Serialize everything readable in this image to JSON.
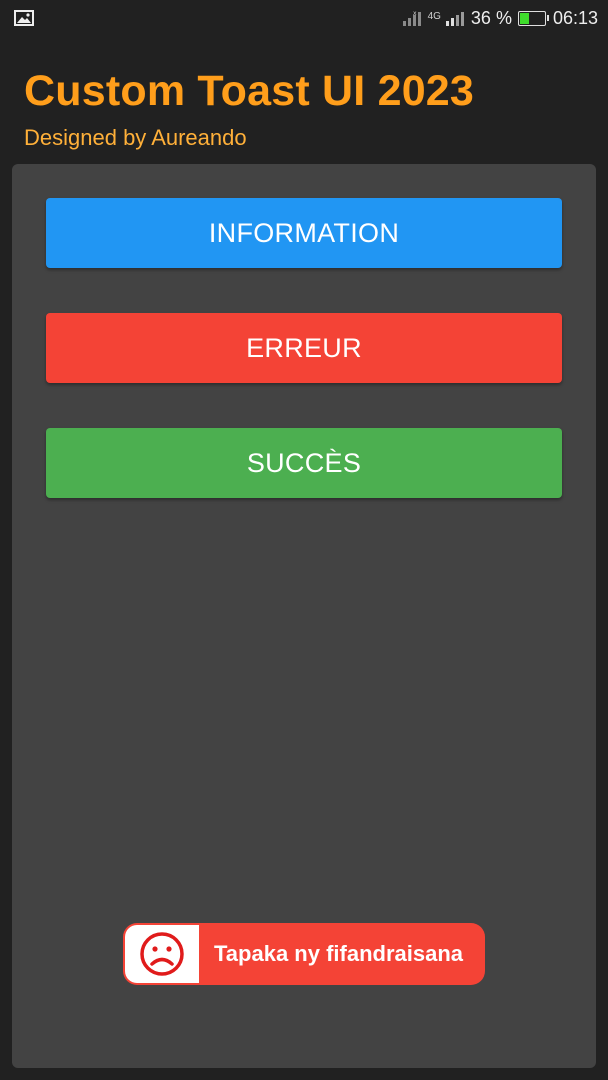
{
  "status_bar": {
    "network_type": "4G",
    "battery_percent": "36 %",
    "battery_level": 0.36,
    "time": "06:13",
    "icons": [
      "gallery-icon",
      "signal-icon",
      "battery-icon"
    ]
  },
  "header": {
    "title": "Custom Toast UI 2023",
    "subtitle": "Designed by Aureando"
  },
  "buttons": {
    "info": "INFORMATION",
    "error": "ERREUR",
    "success": "SUCCÈS"
  },
  "toast": {
    "icon": "sad-face-icon",
    "message": "Tapaka ny fifandraisana"
  },
  "colors": {
    "background": "#212121",
    "card": "#434343",
    "title": "#ff9e1b",
    "info": "#2196f3",
    "error": "#f44336",
    "success": "#4caf50"
  }
}
